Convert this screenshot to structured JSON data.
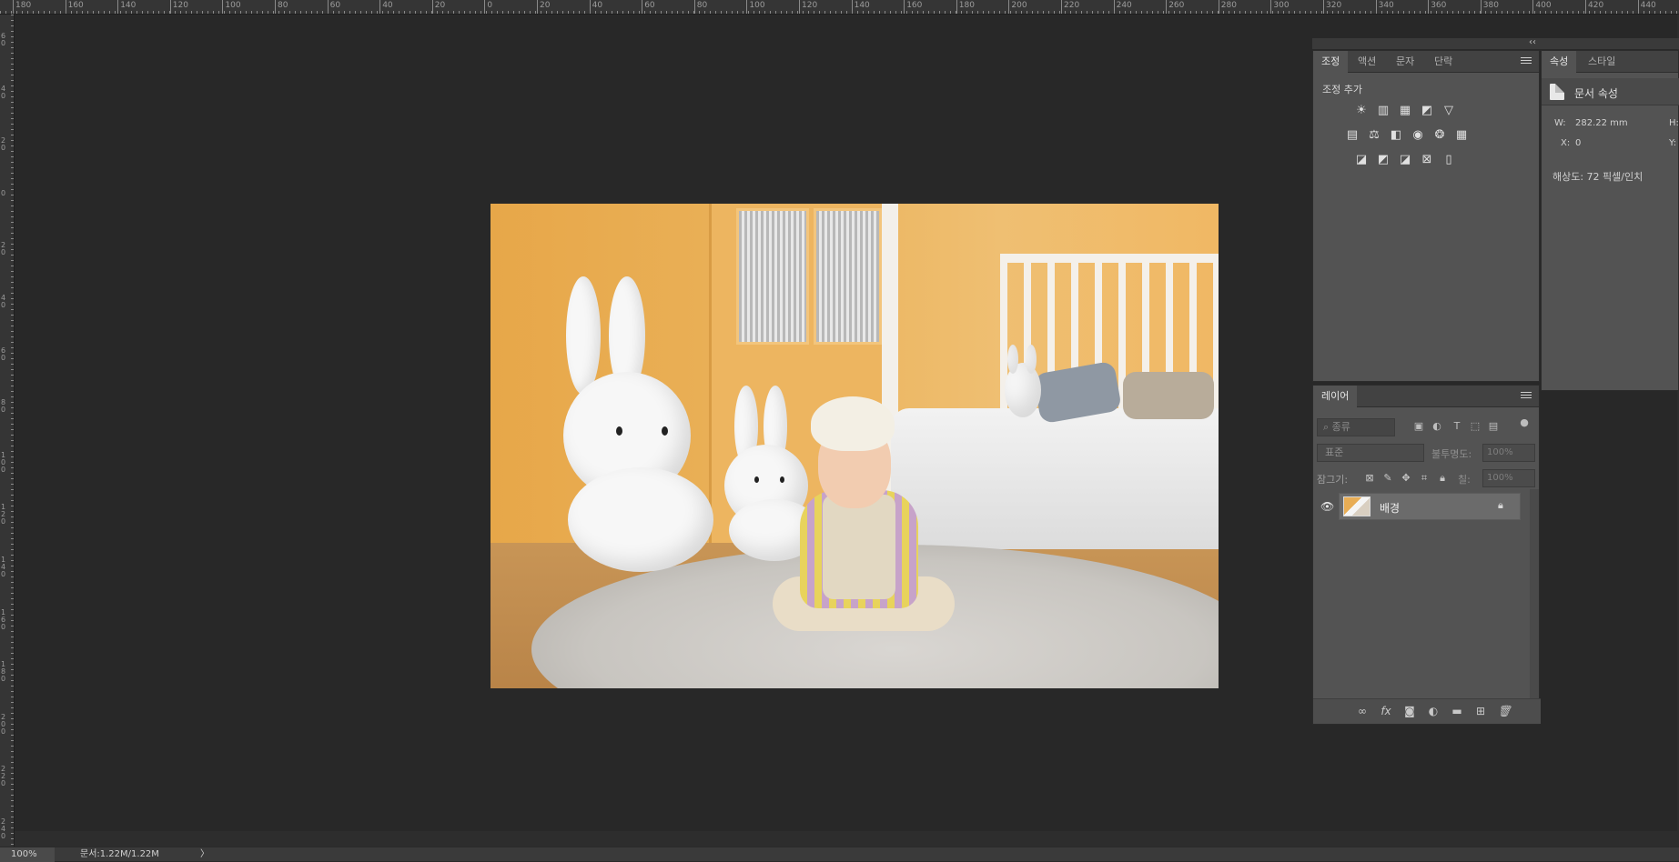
{
  "ruler_top_labels": [
    "180",
    "160",
    "140",
    "120",
    "100",
    "80",
    "60",
    "40",
    "20",
    "0",
    "20",
    "40",
    "60",
    "80",
    "100",
    "120",
    "140",
    "160",
    "180",
    "200",
    "220",
    "240",
    "260",
    "280",
    "300",
    "320",
    "340",
    "360",
    "380",
    "400",
    "420",
    "440"
  ],
  "ruler_left_labels": [
    "60",
    "40",
    "20",
    "0",
    "20",
    "40",
    "60",
    "80",
    "100",
    "120",
    "140",
    "160",
    "180",
    "200",
    "220",
    "240"
  ],
  "adjustments": {
    "tabs": [
      "조정",
      "액션",
      "문자",
      "단락"
    ],
    "title": "조정 추가",
    "row1_icons": [
      "brightness-icon",
      "levels-icon",
      "curves-icon",
      "exposure-icon",
      "vibrance-icon"
    ],
    "row2_icons": [
      "hue-saturation-icon",
      "color-balance-icon",
      "black-white-icon",
      "photo-filter-icon",
      "channel-mixer-icon",
      "color-lookup-icon"
    ],
    "row3_icons": [
      "invert-icon",
      "posterize-icon",
      "threshold-icon",
      "selective-color-icon",
      "gradient-map-icon"
    ]
  },
  "properties": {
    "tabs": [
      "속성",
      "스타일"
    ],
    "title": "문서 속성",
    "w_label": "W:",
    "w_value": "282.22 mm",
    "h_label": "H:",
    "x_label": "X:",
    "x_value": "0",
    "y_label": "Y:",
    "resolution": "해상도: 72 픽셀/인치"
  },
  "layers": {
    "tab": "레이어",
    "filter_placeholder": "종류",
    "blend_mode": "표준",
    "opacity_label": "불투명도:",
    "opacity_value": "100%",
    "lock_label": "잠그기:",
    "fill_label": "칠:",
    "fill_value": "100%",
    "layer_name": "배경"
  },
  "status": {
    "zoom": "100%",
    "doc": "문서:1.22M/1.22M",
    "arrow": "〉"
  },
  "panel_collapse_glyph": "‹‹"
}
